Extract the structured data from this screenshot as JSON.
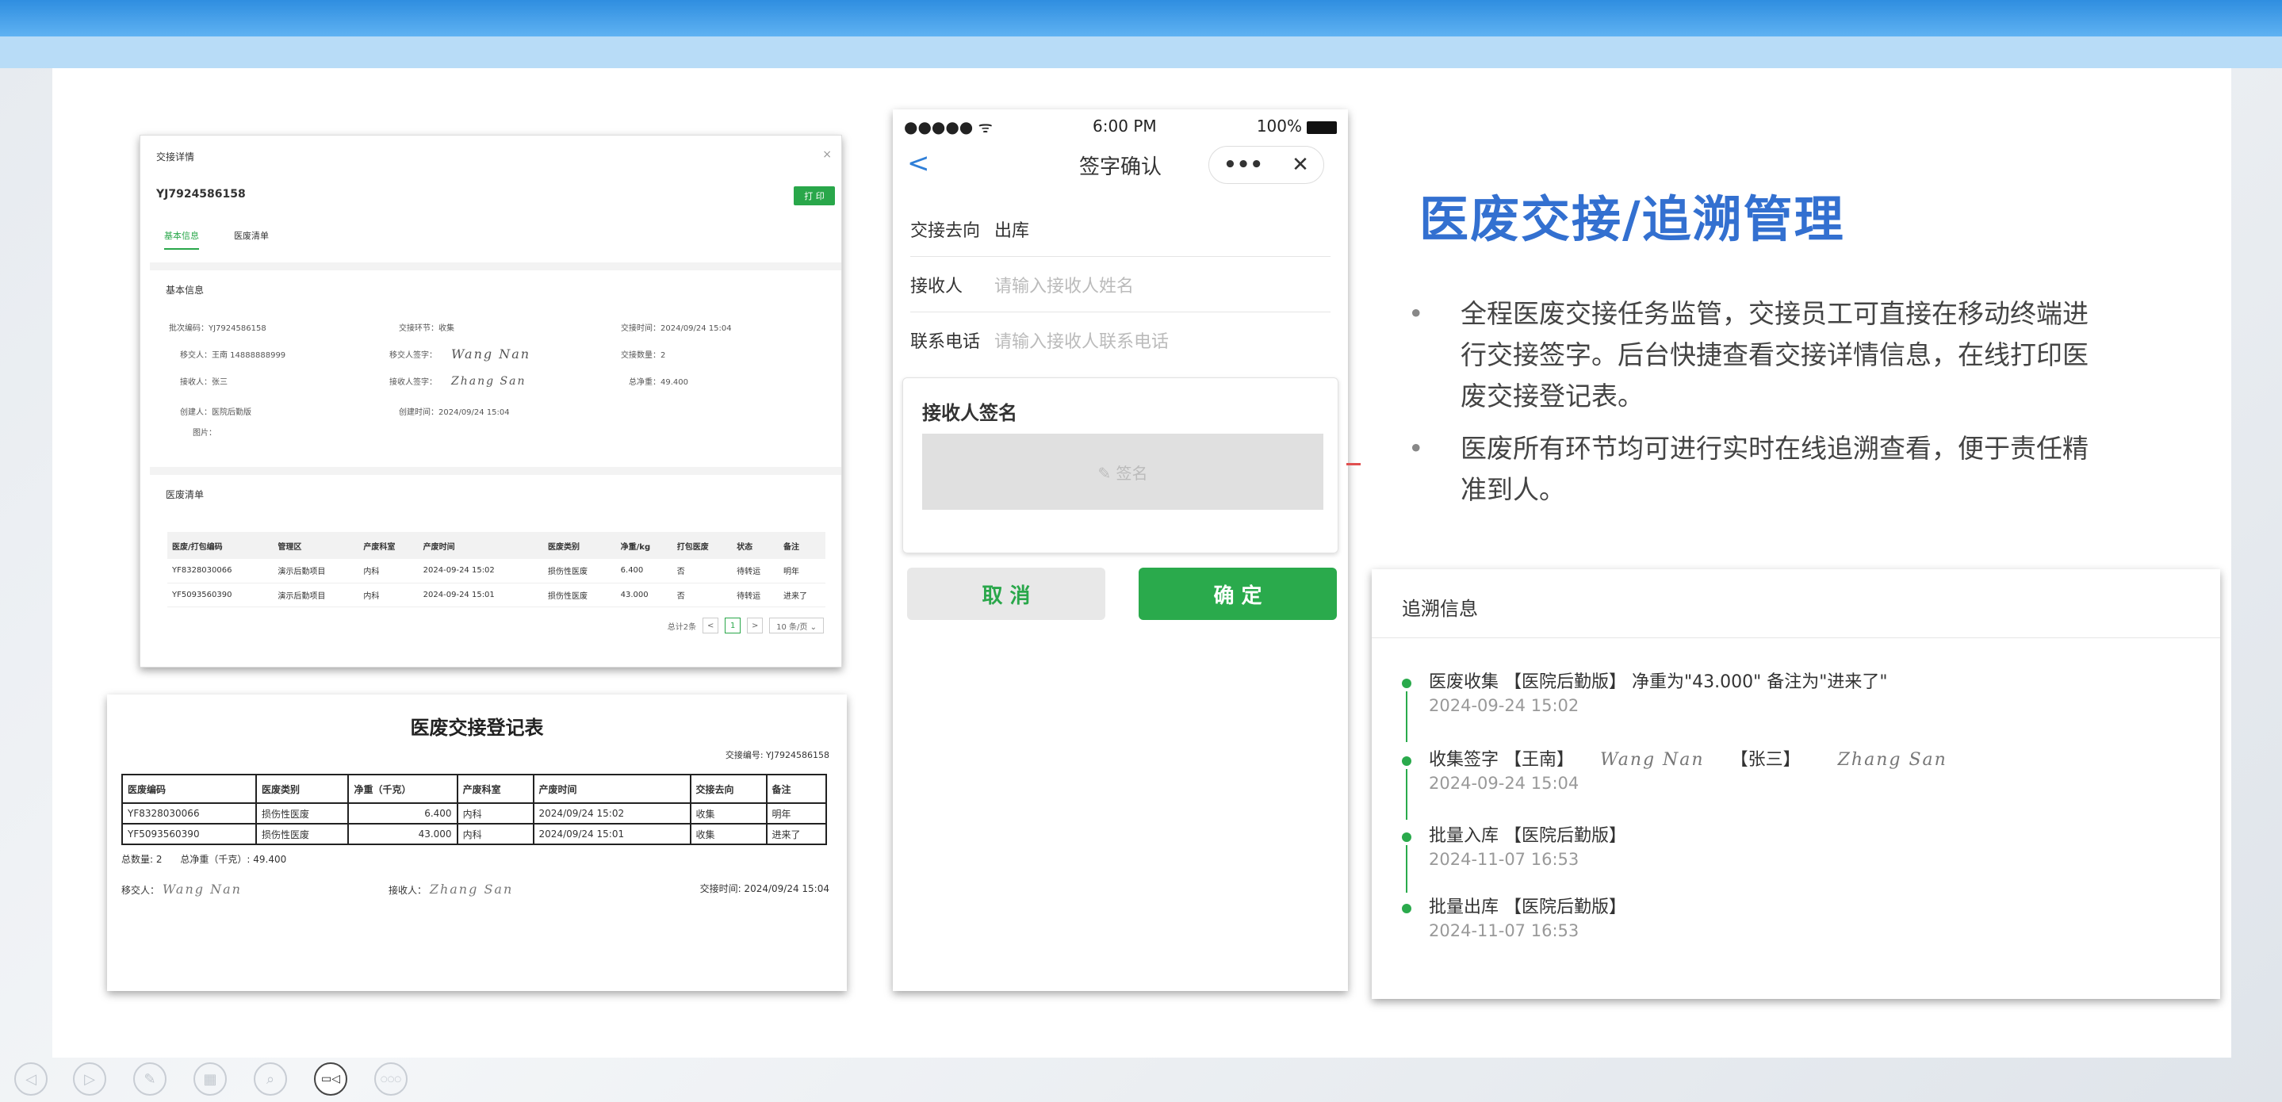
{
  "detail": {
    "window_title": "交接详情",
    "close_glyph": "×",
    "code": "YJ7924586158",
    "print_label": "打 印",
    "tabs": [
      "基本信息",
      "医废清单"
    ],
    "basic_title": "基本信息",
    "fields": {
      "batch_code": "批次编码：YJ7924586158",
      "stage": "交接环节：收集",
      "handover_time": "交接时间：2024/09/24 15:04",
      "sender": "移交人：王南 14888888999",
      "sender_sign": "移交人签字：",
      "handover_count": "交接数量：2",
      "receiver": "接收人：张三",
      "receiver_sign": "接收人签字：",
      "net_weight": "总净重：49.400",
      "creator": "创建人：医院后勤版",
      "created_time": "创建时间：2024/09/24 15:04",
      "photo": "图片："
    },
    "list_title": "医废清单",
    "table_headers": [
      "医废/打包编码",
      "管理区",
      "产废科室",
      "产废时间",
      "医废类别",
      "净重/kg",
      "打包医废",
      "状态",
      "备注"
    ],
    "table_rows": [
      [
        "YF8328030066",
        "演示后勤项目",
        "内科",
        "2024-09-24 15:02",
        "损伤性医废",
        "6.400",
        "否",
        "待转运",
        "明年"
      ],
      [
        "YF5093560390",
        "演示后勤项目",
        "内科",
        "2024-09-24 15:01",
        "损伤性医废",
        "43.000",
        "否",
        "待转运",
        "进来了"
      ]
    ],
    "pager": {
      "total": "总计2条",
      "prev": "<",
      "page": "1",
      "next": ">",
      "size": "10 条/页 ⌄"
    }
  },
  "register": {
    "title": "医废交接登记表",
    "handover_no": "交接编号: YJ7924586158",
    "headers": [
      "医废编码",
      "医废类别",
      "净重（千克）",
      "产废科室",
      "产废时间",
      "交接去向",
      "备注"
    ],
    "rows": [
      [
        "YF8328030066",
        "损伤性医废",
        "6.400",
        "内科",
        "2024/09/24 15:02",
        "收集",
        "明年"
      ],
      [
        "YF5093560390",
        "损伤性医废",
        "43.000",
        "内科",
        "2024/09/24 15:01",
        "收集",
        "进来了"
      ]
    ],
    "total_count": "总数量: 2",
    "total_weight": "总净重（千克）: 49.400",
    "sender_label": "移交人：",
    "receiver_label": "接收人：",
    "handover_time": "交接时间: 2024/09/24 15:04"
  },
  "phone": {
    "signal": "●●●●● ᯤ",
    "time": "6:00 PM",
    "battery": "100%",
    "back_glyph": "<",
    "title": "签字确认",
    "capsule_more": "•••",
    "capsule_close": "✕",
    "direction_label": "交接去向",
    "direction_value": "出库",
    "receiver_label": "接收人",
    "receiver_placeholder": "请输入接收人姓名",
    "phone_label": "联系电话",
    "phone_placeholder": "请输入接收人联系电话",
    "sign_title": "接收人签名",
    "sign_placeholder": "✎ 签名",
    "cancel": "取 消",
    "confirm": "确 定"
  },
  "headline": "医废交接/追溯管理",
  "bullets": [
    "全程医废交接任务监管，交接员工可直接在移动终端进行交接签字。后台快捷查看交接详情信息，在线打印医废交接登记表。",
    "医废所有环节均可进行实时在线追溯查看，便于责任精准到人。"
  ],
  "bullet_dot": "•",
  "trace": {
    "title": "追溯信息",
    "events": [
      {
        "text": "医废收集 【医院后勤版】 净重为\"43.000\" 备注为\"进来了\"",
        "time": "2024-09-24 15:02"
      },
      {
        "text": "收集签字 【王南】",
        "text2": "【张三】",
        "time": "2024-09-24 15:04"
      },
      {
        "text": "批量入库 【医院后勤版】",
        "time": "2024-11-07 16:53"
      },
      {
        "text": "批量出库 【医院后勤版】",
        "time": "2024-11-07 16:53"
      }
    ]
  },
  "signatures": {
    "sender": "Wang Nan",
    "receiver": "Zhang San"
  },
  "toolbar_icons": [
    "prev-icon",
    "next-icon",
    "pen-icon",
    "grid-icon",
    "zoom-icon",
    "camera-icon",
    "more-icon"
  ],
  "toolbar_glyphs": [
    "◁",
    "▷",
    "✎",
    "▦",
    "⌕",
    "▭◁",
    "○○○"
  ],
  "colors": {
    "accent_blue": "#3370d0",
    "green": "#2aaa4c",
    "top_bar": "#2f8ee0"
  }
}
